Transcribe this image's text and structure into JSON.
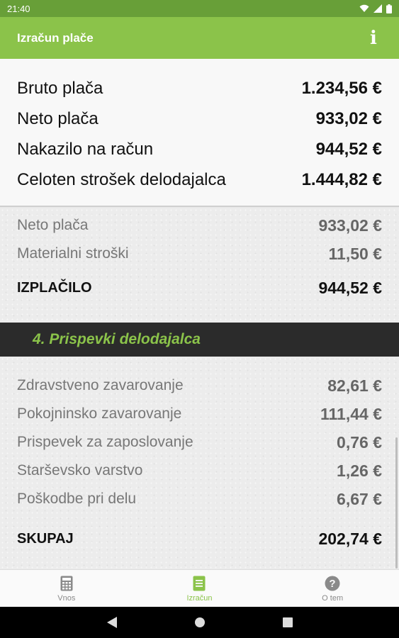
{
  "status_bar": {
    "time": "21:40"
  },
  "app_bar": {
    "title": "Izračun plače",
    "info_icon": "info-icon"
  },
  "summary": [
    {
      "label": "Bruto plača",
      "value": "1.234,56 €"
    },
    {
      "label": "Neto plača",
      "value": "933,02 €"
    },
    {
      "label": "Nakazilo na račun",
      "value": "944,52 €"
    },
    {
      "label": "Celoten strošek delodajalca",
      "value": "1.444,82 €"
    }
  ],
  "payout": {
    "rows": [
      {
        "label": "Neto plača",
        "value": "933,02 €"
      },
      {
        "label": "Materialni stroški",
        "value": "11,50 €"
      }
    ],
    "total": {
      "label": "IZPLAČILO",
      "value": "944,52 €"
    }
  },
  "employer_section": {
    "title": "4. Prispevki delodajalca",
    "rows": [
      {
        "label": "Zdravstveno zavarovanje",
        "value": "82,61 €"
      },
      {
        "label": "Pokojninsko zavarovanje",
        "value": "111,44 €"
      },
      {
        "label": "Prispevek za zaposlovanje",
        "value": "0,76 €"
      },
      {
        "label": "Starševsko varstvo",
        "value": "1,26 €"
      },
      {
        "label": "Poškodbe pri delu",
        "value": "6,67 €"
      }
    ],
    "total": {
      "label": "SKUPAJ",
      "value": "202,74 €"
    }
  },
  "bottom_nav": [
    {
      "label": "Vnos",
      "icon": "calculator-icon",
      "active": false
    },
    {
      "label": "Izračun",
      "icon": "document-icon",
      "active": true
    },
    {
      "label": "O tem",
      "icon": "help-icon",
      "active": false
    }
  ],
  "colors": {
    "accent": "#8bc34a",
    "status_bar": "#689f38",
    "section_header_bg": "#2b2b2b"
  }
}
